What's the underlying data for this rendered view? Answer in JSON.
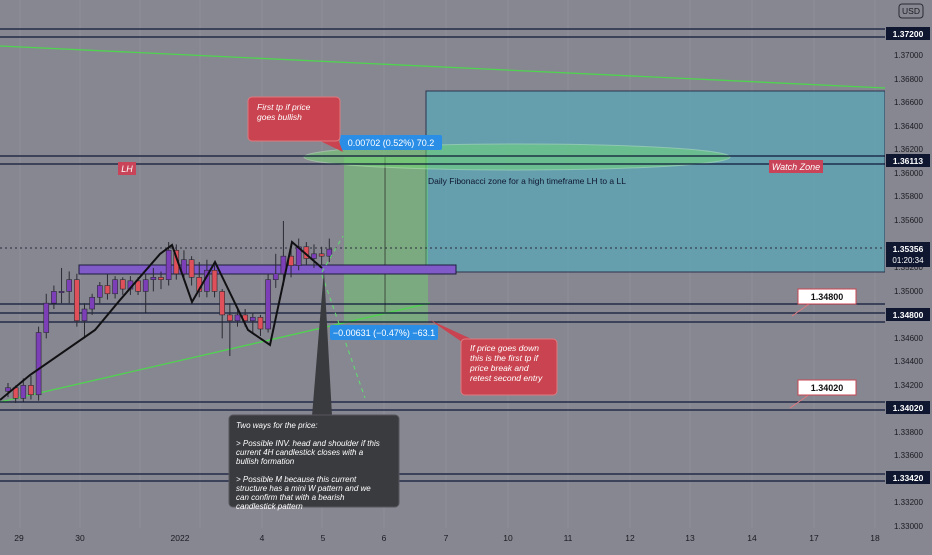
{
  "currency_badge": "USD",
  "price_axis": {
    "ticks": [
      "1.37000",
      "1.36800",
      "1.36600",
      "1.36400",
      "1.36200",
      "1.36000",
      "1.35800",
      "1.35600",
      "1.35200",
      "1.35000",
      "1.34600",
      "1.34400",
      "1.34200",
      "1.33800",
      "1.33600",
      "1.33200",
      "1.33000"
    ],
    "levels": [
      "1.37200",
      "1.36113",
      "1.34800",
      "1.34020",
      "1.33420"
    ],
    "current_price": "1.35356",
    "countdown": "01:20:34"
  },
  "time_axis": {
    "labels": [
      "29",
      "30",
      "2022",
      "4",
      "5",
      "6",
      "7",
      "10",
      "11",
      "12",
      "13",
      "14",
      "17",
      "18"
    ]
  },
  "labels": {
    "lh": "LH",
    "watch_zone": "Watch Zone",
    "fib_zone": "Daily Fibonacci zone for a high timeframe LH to a LL",
    "measure_up": "0.00702 (0.52%) 70.2",
    "measure_down": "−0.00631 (−0.47%) −63.1",
    "callout_1348": "1.34800",
    "callout_1340": "1.34020"
  },
  "notes": {
    "first_tp": [
      "First tp if price",
      "goes bullish"
    ],
    "price_down": [
      "If price goes down",
      "this is the first tp if",
      "price break and",
      "retest second entry"
    ],
    "two_ways": [
      "Two ways for the price:",
      "",
      "> Possible INV.  head and shoulder if this",
      "current 4H candlestick closes with a",
      "bullish formation",
      "",
      "> Possible M because this current",
      "structure has a mini W pattern and we",
      "can confirm that with a bearish",
      "candlestick pattern"
    ]
  },
  "colors": {
    "bull": "#7d3fb8",
    "bear": "#e0505a",
    "zone": "#5aa8b8",
    "fib": "#5fc95f",
    "line": "#0e1838",
    "note_red": "#c94450",
    "note_dark": "#3a3b3f"
  },
  "chart_data": {
    "type": "candlestick",
    "symbol_quote": "USD",
    "ylim": [
      1.33,
      1.375
    ],
    "x_categories": [
      "29",
      "30",
      "2022",
      "4",
      "5",
      "6",
      "7",
      "10",
      "11",
      "12",
      "13",
      "14",
      "17",
      "18"
    ],
    "candles": [
      {
        "o": 1.3415,
        "h": 1.3422,
        "l": 1.341,
        "c": 1.3418
      },
      {
        "o": 1.3418,
        "h": 1.342,
        "l": 1.3405,
        "c": 1.3409
      },
      {
        "o": 1.3409,
        "h": 1.3426,
        "l": 1.3406,
        "c": 1.342
      },
      {
        "o": 1.342,
        "h": 1.3428,
        "l": 1.3408,
        "c": 1.3412
      },
      {
        "o": 1.3412,
        "h": 1.347,
        "l": 1.3407,
        "c": 1.3465
      },
      {
        "o": 1.3465,
        "h": 1.3498,
        "l": 1.346,
        "c": 1.349
      },
      {
        "o": 1.349,
        "h": 1.3505,
        "l": 1.3485,
        "c": 1.35
      },
      {
        "o": 1.35,
        "h": 1.352,
        "l": 1.349,
        "c": 1.35
      },
      {
        "o": 1.35,
        "h": 1.3517,
        "l": 1.349,
        "c": 1.351
      },
      {
        "o": 1.351,
        "h": 1.3515,
        "l": 1.347,
        "c": 1.3475
      },
      {
        "o": 1.3475,
        "h": 1.349,
        "l": 1.346,
        "c": 1.3485
      },
      {
        "o": 1.3485,
        "h": 1.3498,
        "l": 1.348,
        "c": 1.3495
      },
      {
        "o": 1.3495,
        "h": 1.3508,
        "l": 1.349,
        "c": 1.3505
      },
      {
        "o": 1.3505,
        "h": 1.3515,
        "l": 1.3493,
        "c": 1.3498
      },
      {
        "o": 1.3498,
        "h": 1.3513,
        "l": 1.3494,
        "c": 1.351
      },
      {
        "o": 1.351,
        "h": 1.3512,
        "l": 1.3497,
        "c": 1.3502
      },
      {
        "o": 1.3502,
        "h": 1.3513,
        "l": 1.3497,
        "c": 1.3509
      },
      {
        "o": 1.3509,
        "h": 1.3512,
        "l": 1.3497,
        "c": 1.35
      },
      {
        "o": 1.35,
        "h": 1.3515,
        "l": 1.3482,
        "c": 1.351
      },
      {
        "o": 1.351,
        "h": 1.352,
        "l": 1.35,
        "c": 1.3512
      },
      {
        "o": 1.3512,
        "h": 1.3517,
        "l": 1.3502,
        "c": 1.351
      },
      {
        "o": 1.351,
        "h": 1.3542,
        "l": 1.3505,
        "c": 1.3535
      },
      {
        "o": 1.3535,
        "h": 1.354,
        "l": 1.351,
        "c": 1.3515
      },
      {
        "o": 1.3515,
        "h": 1.3535,
        "l": 1.351,
        "c": 1.3527
      },
      {
        "o": 1.3527,
        "h": 1.353,
        "l": 1.3505,
        "c": 1.3512
      },
      {
        "o": 1.3512,
        "h": 1.3525,
        "l": 1.3495,
        "c": 1.35
      },
      {
        "o": 1.35,
        "h": 1.3527,
        "l": 1.3495,
        "c": 1.3518
      },
      {
        "o": 1.3518,
        "h": 1.3522,
        "l": 1.3495,
        "c": 1.35
      },
      {
        "o": 1.35,
        "h": 1.3502,
        "l": 1.346,
        "c": 1.348
      },
      {
        "o": 1.348,
        "h": 1.349,
        "l": 1.3445,
        "c": 1.3475
      },
      {
        "o": 1.3475,
        "h": 1.3485,
        "l": 1.347,
        "c": 1.348
      },
      {
        "o": 1.348,
        "h": 1.3485,
        "l": 1.347,
        "c": 1.3475
      },
      {
        "o": 1.3475,
        "h": 1.3482,
        "l": 1.3465,
        "c": 1.3478
      },
      {
        "o": 1.3478,
        "h": 1.348,
        "l": 1.3462,
        "c": 1.3468
      },
      {
        "o": 1.3468,
        "h": 1.3515,
        "l": 1.3465,
        "c": 1.351
      },
      {
        "o": 1.351,
        "h": 1.3532,
        "l": 1.3503,
        "c": 1.3515
      },
      {
        "o": 1.3515,
        "h": 1.356,
        "l": 1.3505,
        "c": 1.353
      },
      {
        "o": 1.353,
        "h": 1.3536,
        "l": 1.3512,
        "c": 1.3522
      },
      {
        "o": 1.3522,
        "h": 1.3545,
        "l": 1.3518,
        "c": 1.3538
      },
      {
        "o": 1.3538,
        "h": 1.3542,
        "l": 1.3522,
        "c": 1.3528
      },
      {
        "o": 1.3528,
        "h": 1.354,
        "l": 1.352,
        "c": 1.3532
      },
      {
        "o": 1.3532,
        "h": 1.3538,
        "l": 1.3522,
        "c": 1.353
      },
      {
        "o": 1.353,
        "h": 1.3545,
        "l": 1.3525,
        "c": 1.3536
      }
    ],
    "horizontal_levels": [
      1.372,
      1.36113,
      1.348,
      1.3402,
      1.3342
    ],
    "supply_zone": {
      "top": 1.3667,
      "bottom": 1.3519
    },
    "demand_band": {
      "top": 1.3527,
      "bottom": 1.3518
    },
    "current_price": 1.35356,
    "measure_up": {
      "from": 1.354,
      "to": 1.3611,
      "text": "0.00702 (0.52%) 70.2"
    },
    "measure_down": {
      "from": 1.354,
      "to": 1.3477,
      "text": "−0.00631 (−0.47%) −63.1"
    }
  }
}
